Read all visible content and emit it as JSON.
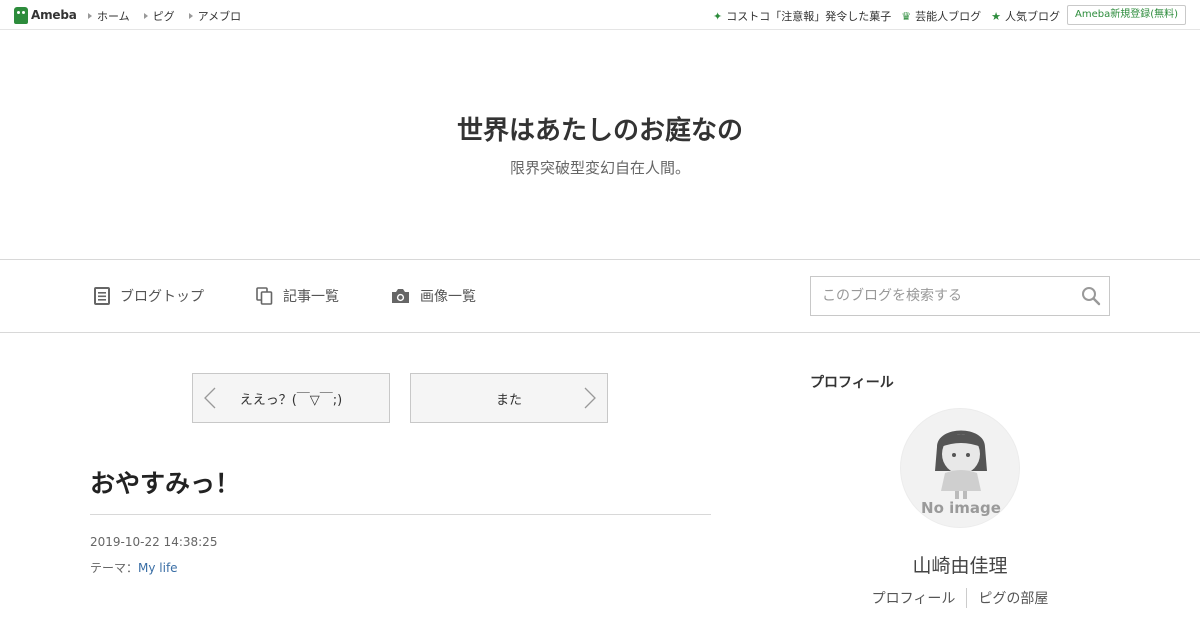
{
  "topbar": {
    "logo_text": "Ameba",
    "left_links": [
      "ホーム",
      "ピグ",
      "アメブロ"
    ],
    "right_links": [
      {
        "icon": "sparkle-icon",
        "label": "コストコ「注意報」発令した菓子"
      },
      {
        "icon": "crown-icon",
        "label": "芸能人ブログ"
      },
      {
        "icon": "star-icon",
        "label": "人気ブログ"
      }
    ],
    "register_label": "Ameba新規登録(無料)"
  },
  "header": {
    "title": "世界はあたしのお庭なの",
    "description": "限界突破型変幻自在人間。"
  },
  "nav": {
    "items": [
      {
        "icon": "document-icon",
        "label": "ブログトップ"
      },
      {
        "icon": "copy-icon",
        "label": "記事一覧"
      },
      {
        "icon": "camera-icon",
        "label": "画像一覧"
      }
    ],
    "search_placeholder": "このブログを検索する"
  },
  "pager": {
    "prev_label": "ええっ？(￣▽￣;)",
    "next_label": "また"
  },
  "entry": {
    "title": "おやすみっ！",
    "date": "2019-10-22 14:38:25",
    "theme_label": "テーマ：",
    "theme_value": "My life"
  },
  "sidebar": {
    "heading": "プロフィール",
    "avatar_text": "No image",
    "name": "山崎由佳理",
    "links": [
      "プロフィール",
      "ピグの部屋"
    ]
  },
  "colors": {
    "brand_green": "#2d8c3c",
    "link_blue": "#3a6ea5"
  }
}
